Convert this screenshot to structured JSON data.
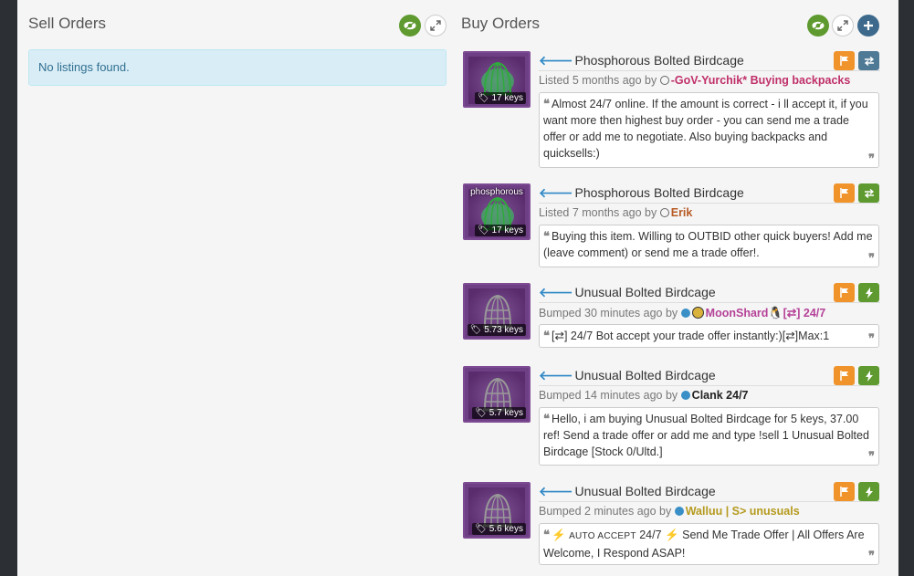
{
  "sell": {
    "title": "Sell Orders",
    "empty_text": "No listings found."
  },
  "buy": {
    "title": "Buy Orders"
  },
  "colors": {
    "accent_green": "#5e9a2f",
    "flag_orange": "#f0932a",
    "trade_steel": "#4f7a96",
    "info_blue": "#d9edf7"
  },
  "listings": [
    {
      "item": "Phosphorous Bolted Birdcage",
      "price": "17 keys",
      "meta_prefix": "Listed 5 months ago by",
      "user": "-GoV-Yurchik* Buying backpacks",
      "user_color": "#c0306a",
      "message": "Almost 24/7 online. If the amount is correct - i ll accept it, if you want more then highest buy order - you can send me a trade offer or add me to negotiate. Also buying backpacks and quicksells:)",
      "action_icon": "trade-offer-icon"
    },
    {
      "item": "Phosphorous Bolted Birdcage",
      "price": "17 keys",
      "overlay": "phosphorous",
      "meta_prefix": "Listed 7 months ago by",
      "user": "Erik",
      "user_color": "#b85a24",
      "message": "Buying this item. Willing to OUTBID other quick buyers! Add me (leave comment) or send me a trade offer!.",
      "action_icon": "trade-offer-icon"
    },
    {
      "item": "Unusual Bolted Birdcage",
      "price": "5.73 keys",
      "meta_prefix": "Bumped 30 minutes ago by",
      "user": "MoonShard",
      "user_suffix": "[⇄] 24/7",
      "user_color": "#b54298",
      "message": "[⇄] 24/7 Bot accept your trade offer instantly:)[⇄]Max:1",
      "action_icon": "instant-trade-icon"
    },
    {
      "item": "Unusual Bolted Birdcage",
      "price": "5.7 keys",
      "meta_prefix": "Bumped 14 minutes ago by",
      "user": "Clank 24/7",
      "user_color": "#222222",
      "message": "Hello, i am buying Unusual Bolted Birdcage for 5 keys, 37.00 ref! Send a trade offer or add me and type !sell 1 Unusual Bolted Birdcage [Stock 0/Ultd.]",
      "action_icon": "instant-trade-icon"
    },
    {
      "item": "Unusual Bolted Birdcage",
      "price": "5.6 keys",
      "meta_prefix": "Bumped 2 minutes ago by",
      "user": "Walluu | S> unusuals",
      "user_color": "#b59a1e",
      "message_caps": "AUTO ACCEPT",
      "message_rest": "24/7",
      "message_tail": "Send Me Trade Offer | All Offers Are Welcome, I Respond ASAP!",
      "action_icon": "instant-trade-icon"
    }
  ]
}
